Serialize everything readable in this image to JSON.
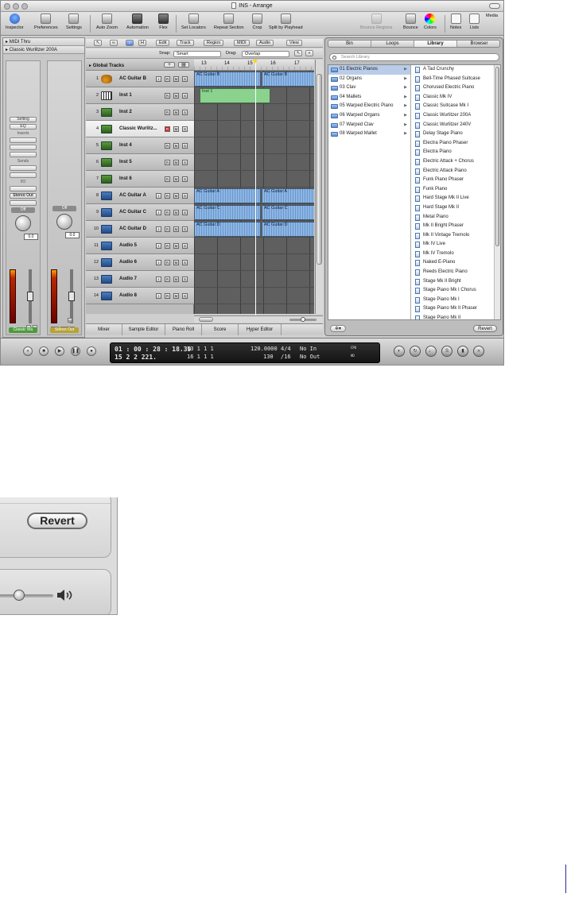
{
  "window": {
    "title": "INS - Arrange"
  },
  "toolbar": {
    "items": [
      "Inspector",
      "Preferences",
      "Settings",
      "Auto Zoom",
      "Automation",
      "Flex",
      "Set Locators",
      "Repeat Section",
      "Crop",
      "Split by Playhead",
      "Bounce Regions",
      "Bounce",
      "Colors",
      "Notes",
      "Lists",
      "Media"
    ]
  },
  "inspector": {
    "region1": "MIDI Thru",
    "region2": "Classic Wurlitzer 200A",
    "setting": "Setting",
    "eq": "EQ",
    "inserts": "Inserts",
    "sends": "Sends",
    "io": "I/O",
    "output": "Stereo Out",
    "off1": "Off",
    "off2": "Off",
    "vol1": "0.0",
    "vol2": "0.0",
    "peak1": "0.0",
    "peak2": "0.0",
    "m": "M",
    "s": "S",
    "bnce": "Bnce",
    "strip1_name": "Classic Wu",
    "strip2_name": "Stereo Out"
  },
  "arrange": {
    "menus": [
      "Edit",
      "Track",
      "Region",
      "MIDI",
      "Audio",
      "View"
    ],
    "snap_label": "Snap:",
    "snap_value": "Smart",
    "drag_label": "Drag:",
    "drag_value": "Overlap",
    "global_tracks": "Global Tracks",
    "ruler": [
      "13",
      "14",
      "15",
      "16",
      "17"
    ],
    "tracks": [
      {
        "num": "1",
        "name": "AC Guitar B",
        "type": "guitar"
      },
      {
        "num": "2",
        "name": "Inst 1",
        "type": "keys"
      },
      {
        "num": "3",
        "name": "Inst 2",
        "type": "inst"
      },
      {
        "num": "4",
        "name": "Classic Wurlitz...",
        "type": "inst"
      },
      {
        "num": "5",
        "name": "Inst 4",
        "type": "inst"
      },
      {
        "num": "6",
        "name": "Inst 5",
        "type": "inst"
      },
      {
        "num": "7",
        "name": "Inst 6",
        "type": "inst"
      },
      {
        "num": "8",
        "name": "AC Guitar A",
        "type": "audio"
      },
      {
        "num": "9",
        "name": "AC Guitar C",
        "type": "audio"
      },
      {
        "num": "10",
        "name": "AC Guitar D",
        "type": "audio"
      },
      {
        "num": "11",
        "name": "Audio 5",
        "type": "audio"
      },
      {
        "num": "12",
        "name": "Audio 6",
        "type": "audio"
      },
      {
        "num": "13",
        "name": "Audio 7",
        "type": "audio"
      },
      {
        "num": "14",
        "name": "Audio 8",
        "type": "audio"
      }
    ],
    "regions": {
      "guitar_b": "AC Guitar B",
      "inst1": "Inst 1",
      "guitar_a": "AC Guitar A",
      "guitar_c": "AC Guitar C",
      "guitar_d": "AC Guitar D"
    },
    "bottom_tabs": [
      "Mixer",
      "Sample Editor",
      "Piano Roll",
      "Score",
      "Hyper Editor"
    ]
  },
  "media": {
    "tabs": [
      "Bin",
      "Loops",
      "Library",
      "Browser"
    ],
    "active_tab": "Library",
    "search_placeholder": "Search Library",
    "folders": [
      "01 Electric Pianos",
      "02 Organs",
      "03 Clav",
      "04 Mallets",
      "05 Warped Electric Piano",
      "06 Warped Organs",
      "07 Warped Clav",
      "08 Warped Mallet"
    ],
    "patches": [
      "A Tad Crunchy",
      "Bell-Time Phased Suitcase",
      "Chorused Electric Piano",
      "Classic Mk IV",
      "Classic Suitcase Mk I",
      "Classic Wurlitzer 200A",
      "Classic Wurlitzer 240V",
      "Delay Stage Piano",
      "Electra Piano Phaser",
      "Electra Piano",
      "Electric Attack + Chorus",
      "Electric Attack Piano",
      "Funk Piano Phaser",
      "Funk Piano",
      "Hard Stage Mk II Live",
      "Hard Stage Mk II",
      "Metal Piano",
      "Mk II Bright Phaser",
      "Mk II Vintage Tremolo",
      "Mk IV Live",
      "Mk IV Tremolo",
      "Naked E-Piano",
      "Reeds Electric Piano",
      "Stage Mk II Bright",
      "Stage Piano Mk I Chorus",
      "Stage Piano Mk I",
      "Stage Piano Mk II Phaser",
      "Stage Piano Mk II"
    ],
    "revert": "Revert"
  },
  "transport": {
    "smpte": "01 : 00 : 28 : 18.39",
    "bar_pos": "15    2    2  221.",
    "left_loc": "13    1    1      1",
    "right_loc": "16    1    1      1",
    "tempo": "120.0000",
    "tempo2": "130",
    "sig": "4/4",
    "division": "/16",
    "midi_in": "No In",
    "midi_out": "No Out",
    "cpu": "CPU",
    "hd": "HD"
  },
  "detail": {
    "revert": "Revert",
    "volume_level": 0.5
  }
}
